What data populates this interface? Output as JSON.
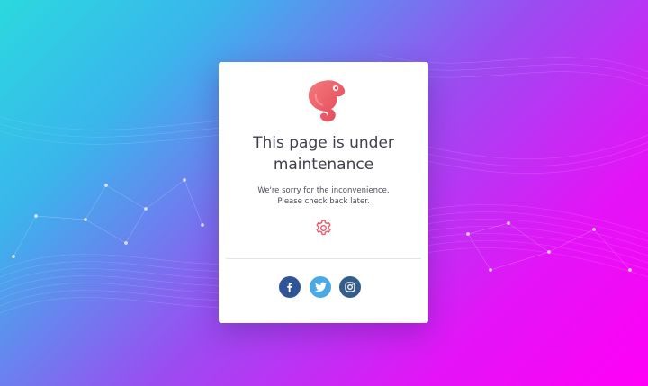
{
  "page": {
    "title_line1": "This page is under",
    "title_line2": "maintenance",
    "message_line1": "We're sorry for the inconvenience.",
    "message_line2": "Please check back later."
  },
  "icons": {
    "logo": "chameleon-logo-icon",
    "status": "gear-icon",
    "social": [
      "facebook-icon",
      "twitter-icon",
      "instagram-icon"
    ]
  },
  "colors": {
    "background_gradient": [
      "#2bd9de",
      "#3ab5ec",
      "#9b4cf1",
      "#e314f7",
      "#ff00f6"
    ],
    "accent": "#ef5b6a",
    "title": "#3f3f4c",
    "facebook": "#2f5596",
    "twitter": "#49a8e6",
    "instagram": "#335d8c"
  }
}
